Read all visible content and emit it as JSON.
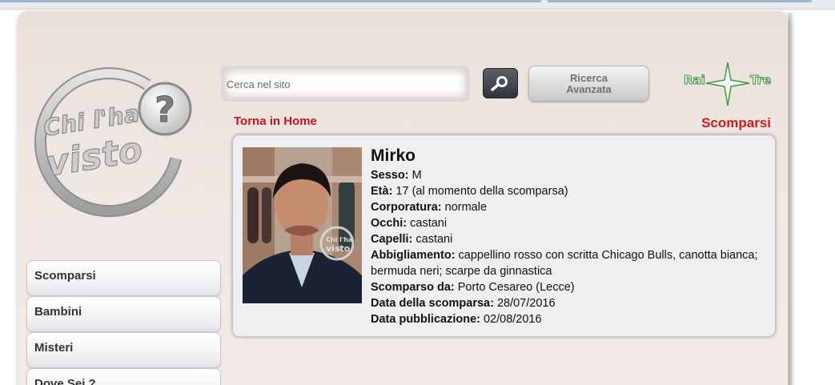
{
  "logo": {
    "line1": "Chi l'ha",
    "line2": "visto",
    "mark": "?"
  },
  "search": {
    "placeholder": "Cerca nel sito",
    "button_icon": "search-icon"
  },
  "advanced_search": {
    "line1": "Ricerca",
    "line2": "Avanzata"
  },
  "channel_logo": {
    "left": "Rai",
    "right": "Tre"
  },
  "nav": {
    "home_link": "Torna in Home",
    "section_title": "Scomparsi"
  },
  "sidebar": {
    "items": [
      {
        "label": "Scomparsi"
      },
      {
        "label": "Bambini"
      },
      {
        "label": "Misteri"
      },
      {
        "label": "Dove Sei ?"
      }
    ]
  },
  "person": {
    "name": "Mirko",
    "photo_watermark": {
      "line1": "Chi l'ha",
      "line2": "visto"
    },
    "fields": [
      {
        "label": "Sesso:",
        "value": "M"
      },
      {
        "label": "Età:",
        "value": "17 (al momento della scomparsa)"
      },
      {
        "label": "Corporatura:",
        "value": "normale"
      },
      {
        "label": "Occhi:",
        "value": "castani"
      },
      {
        "label": "Capelli:",
        "value": "castani"
      },
      {
        "label": "Abbigliamento:",
        "value": "cappellino rosso con scritta Chicago Bulls, canotta bianca; bermuda neri; scarpe da ginnastica"
      },
      {
        "label": "Scomparso da:",
        "value": "Porto Cesareo (Lecce)"
      },
      {
        "label": "Data della scomparsa:",
        "value": "28/07/2016"
      },
      {
        "label": "Data pubblicazione:",
        "value": "02/08/2016"
      }
    ]
  },
  "colors": {
    "accent_red": "#c8141e",
    "page_bg": "#efe7e2",
    "card_bg": "#efeef0"
  }
}
